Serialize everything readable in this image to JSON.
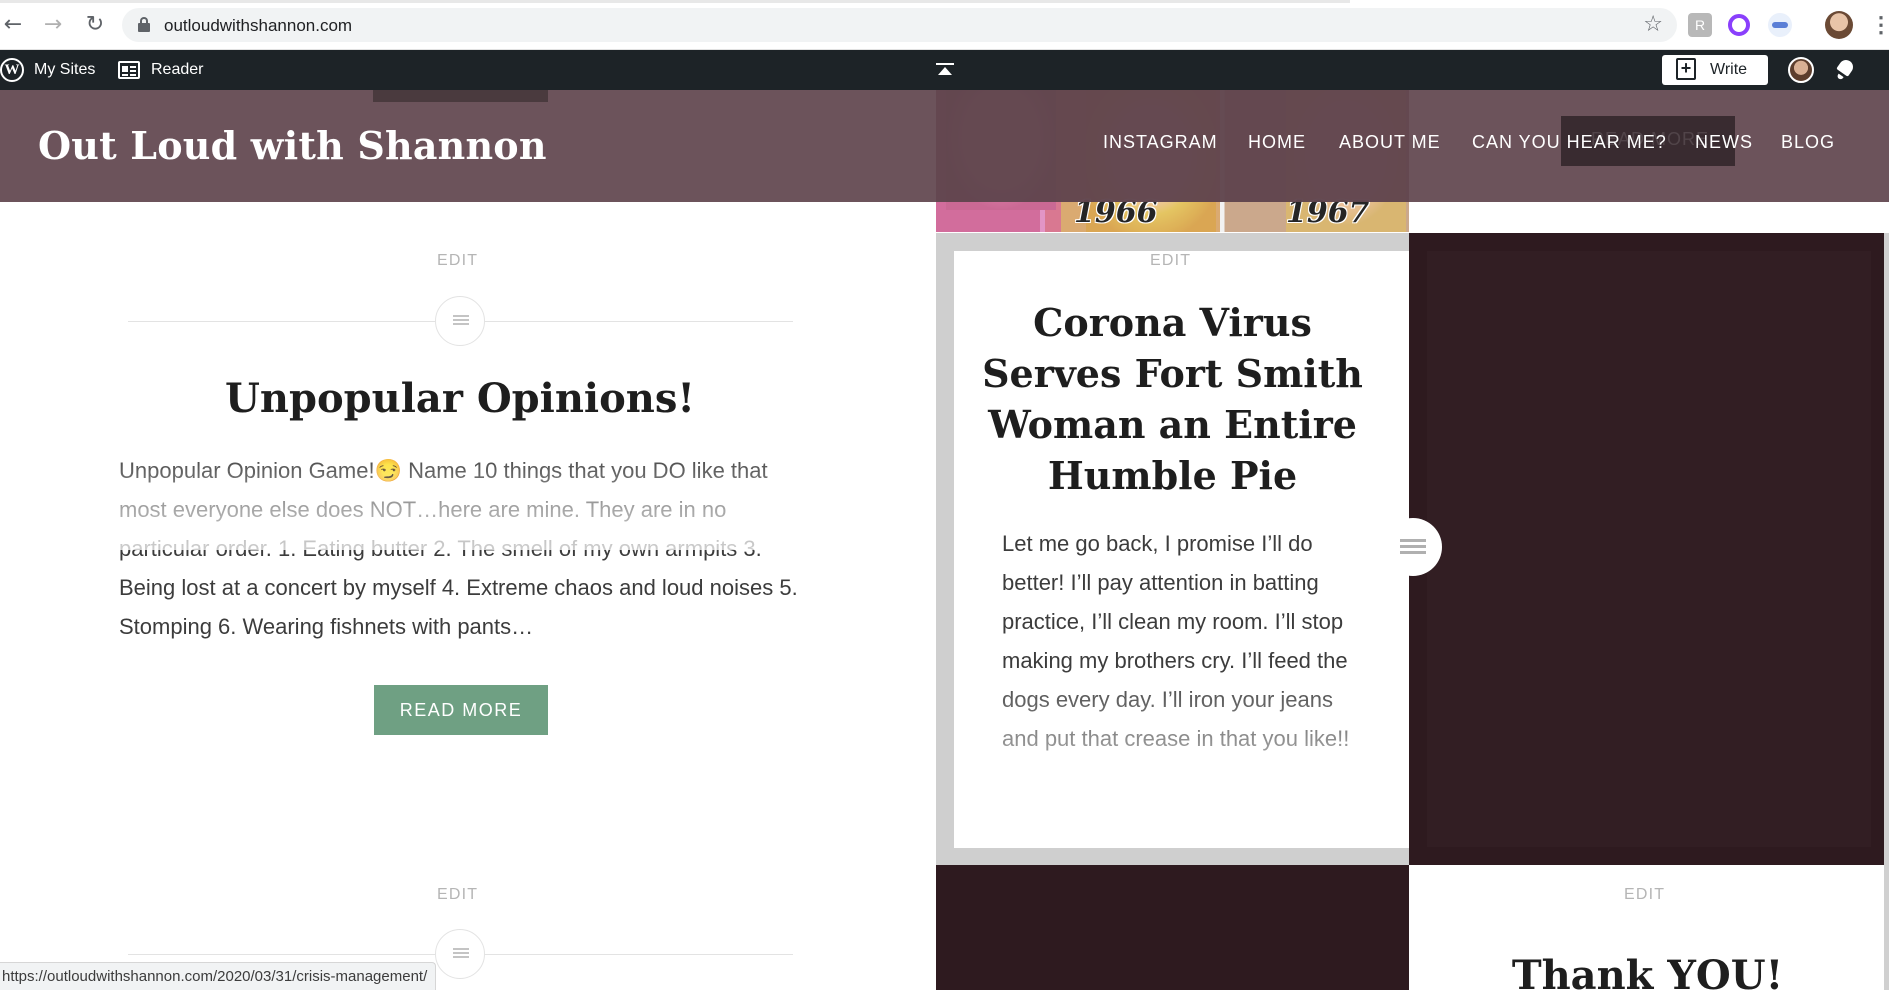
{
  "browser": {
    "url": "outloudwithshannon.com",
    "status_url": "https://outloudwithshannon.com/2020/03/31/crisis-management/"
  },
  "wp_admin_bar": {
    "my_sites": "My Sites",
    "reader": "Reader",
    "write": "Write"
  },
  "site": {
    "title": "Out Loud with Shannon",
    "menu": [
      "INSTAGRAM",
      "HOME",
      "ABOUT ME",
      "CAN YOU HEAR ME?",
      "NEWS",
      "BLOG"
    ],
    "faded_button": "READ MORE"
  },
  "featured_image": {
    "year_left": "1966",
    "year_right": "1967"
  },
  "posts": [
    {
      "edit": "EDIT",
      "title": "Unpopular Opinions!",
      "excerpt": "Unpopular Opinion Game!😏 Name 10 things that you DO like that most everyone else does NOT…here are mine. They are in no particular order. 1. Eating butter 2. The smell of my own armpits 3. Being lost at a concert by myself 4. Extreme chaos and loud noises 5. Stomping 6. Wearing fishnets with pants…",
      "read_more": "READ MORE"
    },
    {
      "edit": "EDIT",
      "title": "Corona Virus Serves Fort Smith Woman an Entire Humble Pie",
      "excerpt": "Let me go back, I promise I’ll do better! I’ll pay attention in batting practice, I’ll clean my room. I’ll stop making my brothers cry.  I’ll feed the dogs every day.  I’ll iron your jeans and put that crease in that you like!!"
    },
    {
      "edit": "EDIT"
    },
    {
      "edit": "EDIT",
      "title": "Thank YOU!"
    }
  ],
  "colors": {
    "header": "#61464f",
    "read_more_button": "#6fa083",
    "dark_panel": "#2e1a1f",
    "admin_bar": "#1d2327"
  }
}
